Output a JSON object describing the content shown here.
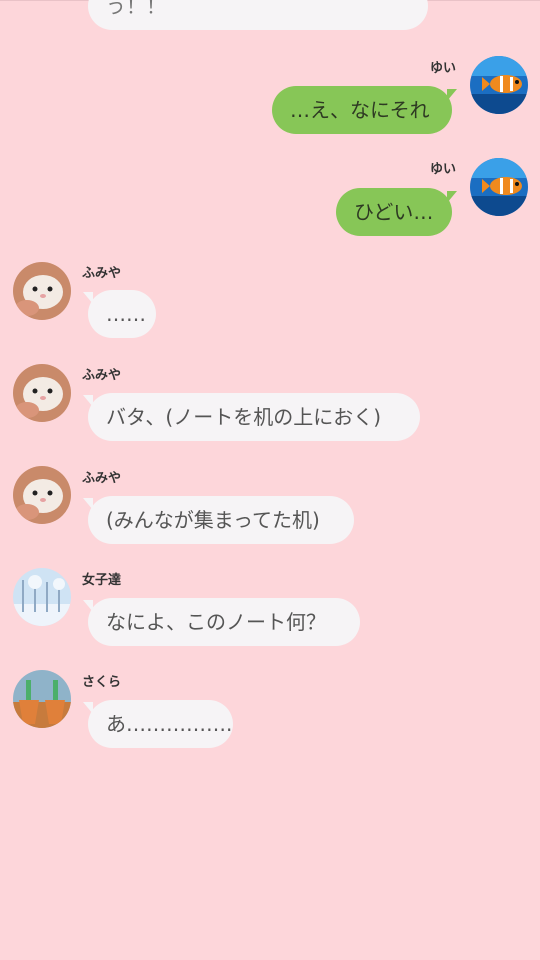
{
  "messages": [
    {
      "sender": "",
      "text": "う！！"
    },
    {
      "sender": "ゆい",
      "text": "…え、なにそれ",
      "avatar_icon": "clownfish-avatar"
    },
    {
      "sender": "ゆい",
      "text": "ひどい…",
      "avatar_icon": "clownfish-avatar"
    },
    {
      "sender": "ふみや",
      "text": "……",
      "avatar_icon": "hamster-avatar"
    },
    {
      "sender": "ふみや",
      "text": "バタ、(ノートを机の上におく)",
      "avatar_icon": "hamster-avatar"
    },
    {
      "sender": "ふみや",
      "text": "(みんなが集まってた机)",
      "avatar_icon": "hamster-avatar"
    },
    {
      "sender": "女子達",
      "text": "なによ、このノート何？",
      "avatar_icon": "snowy-trees-avatar"
    },
    {
      "sender": "さくら",
      "text": "あ…………….",
      "avatar_icon": "flower-pots-avatar"
    }
  ],
  "colors": {
    "background": "#fdd6da",
    "incoming_bubble": "#f6f4f6",
    "outgoing_bubble": "#87c657"
  }
}
